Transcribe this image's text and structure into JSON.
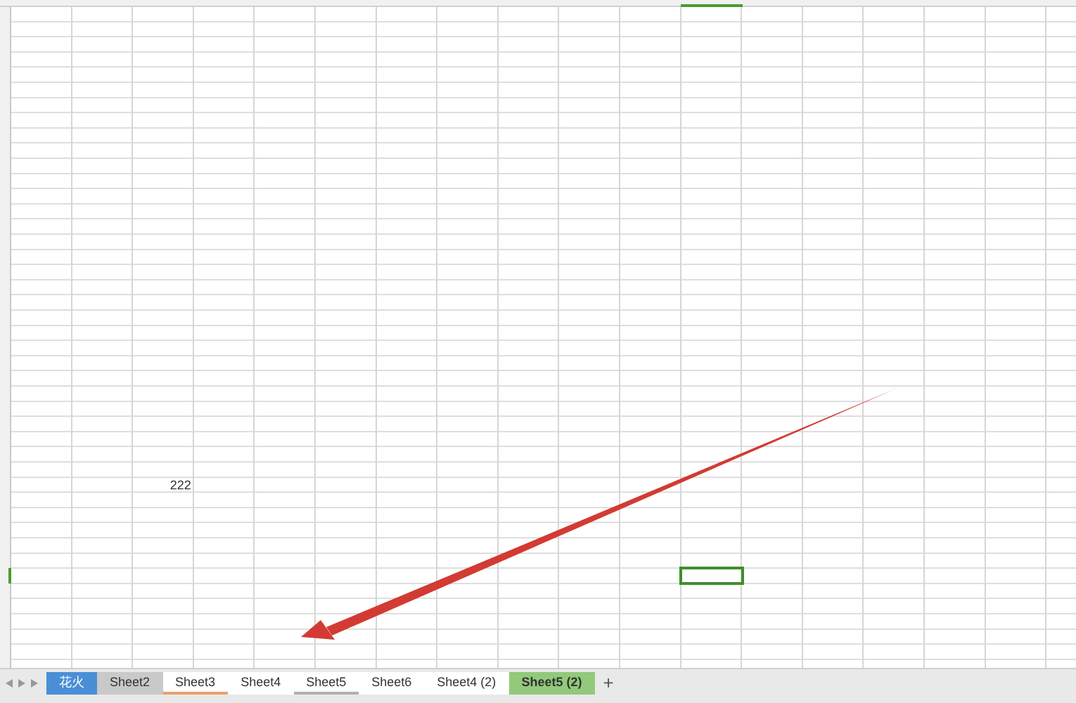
{
  "sheet": {
    "cells": [
      {
        "value": "222"
      }
    ]
  },
  "sheet_tabs": [
    {
      "label": "花火",
      "selected": false,
      "color": "#4a8fd6"
    },
    {
      "label": "Sheet2",
      "selected": false,
      "color": "#c9c9c9"
    },
    {
      "label": "Sheet3",
      "selected": false,
      "color": "#e8a070"
    },
    {
      "label": "Sheet4",
      "selected": false
    },
    {
      "label": "Sheet5",
      "selected": false,
      "color": "#b0b0b0"
    },
    {
      "label": "Sheet6",
      "selected": false
    },
    {
      "label": "Sheet4 (2)",
      "selected": false
    },
    {
      "label": "Sheet5 (2)",
      "selected": true,
      "color": "#92c97a"
    }
  ],
  "add_sheet": "+"
}
